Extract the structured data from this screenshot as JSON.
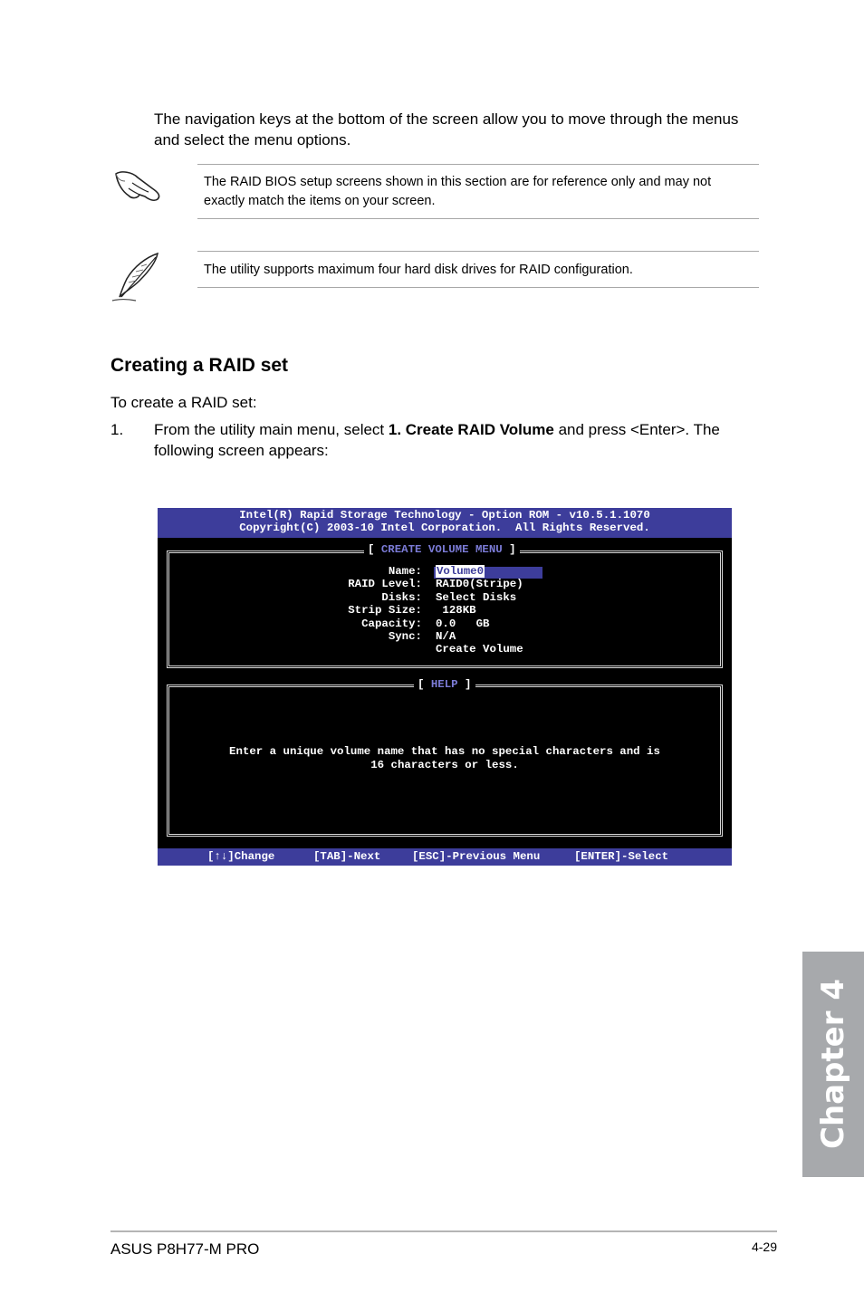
{
  "intro": {
    "text_line1": "The navigation keys at the bottom of the screen allow you to move through the menus",
    "text_line2": "and select the menu options."
  },
  "notes": [
    {
      "icon": "pointing-hand-icon",
      "line1": "The RAID BIOS setup screens shown in this section are for reference only and may not",
      "line2": "exactly match the items on your screen."
    },
    {
      "icon": "feather-pen-icon",
      "line1": "The utility supports maximum four hard disk drives for RAID configuration."
    }
  ],
  "section": {
    "title": "Creating a RAID set",
    "lead": "To create a RAID set:",
    "step_number": "1.",
    "step_pre": "From the utility main menu, select ",
    "step_bold": "1. Create RAID Volume",
    "step_post": " and press <Enter>. The",
    "step_line2": "following screen appears:"
  },
  "bios": {
    "header_line1": "Intel(R) Rapid Storage Technology - Option ROM - v10.5.1.1070",
    "header_line2": "Copyright(C) 2003-10 Intel Corporation.  All Rights Reserved.",
    "menu_title": "CREATE VOLUME MENU",
    "fields": [
      {
        "label": "Name:",
        "value": "Volume0"
      },
      {
        "label": "RAID Level:",
        "value": "RAID0(Stripe)"
      },
      {
        "label": "Disks:",
        "value": "Select Disks"
      },
      {
        "label": "Strip Size:",
        "value": " 128KB"
      },
      {
        "label": "Capacity:",
        "value": "0.0   GB"
      },
      {
        "label": "Sync:",
        "value": "N/A"
      }
    ],
    "create_volume": "Create Volume",
    "help_title": "HELP",
    "help_line1": "Enter a unique volume name that has no special characters and is",
    "help_line2": "16 characters or less.",
    "footer": {
      "change": "[↑↓]Change",
      "next": "[TAB]-Next",
      "previous": "[ESC]-Previous Menu",
      "select": "[ENTER]-Select"
    },
    "colors": {
      "bar": "#3d3d9b",
      "accent": "#7b7bd6",
      "screen": "#000000"
    }
  },
  "chapter_tab": {
    "label": "Chapter 4",
    "color": "#a7a9ac"
  },
  "footer": {
    "product": "ASUS P8H77-M PRO",
    "page": "4-29"
  }
}
